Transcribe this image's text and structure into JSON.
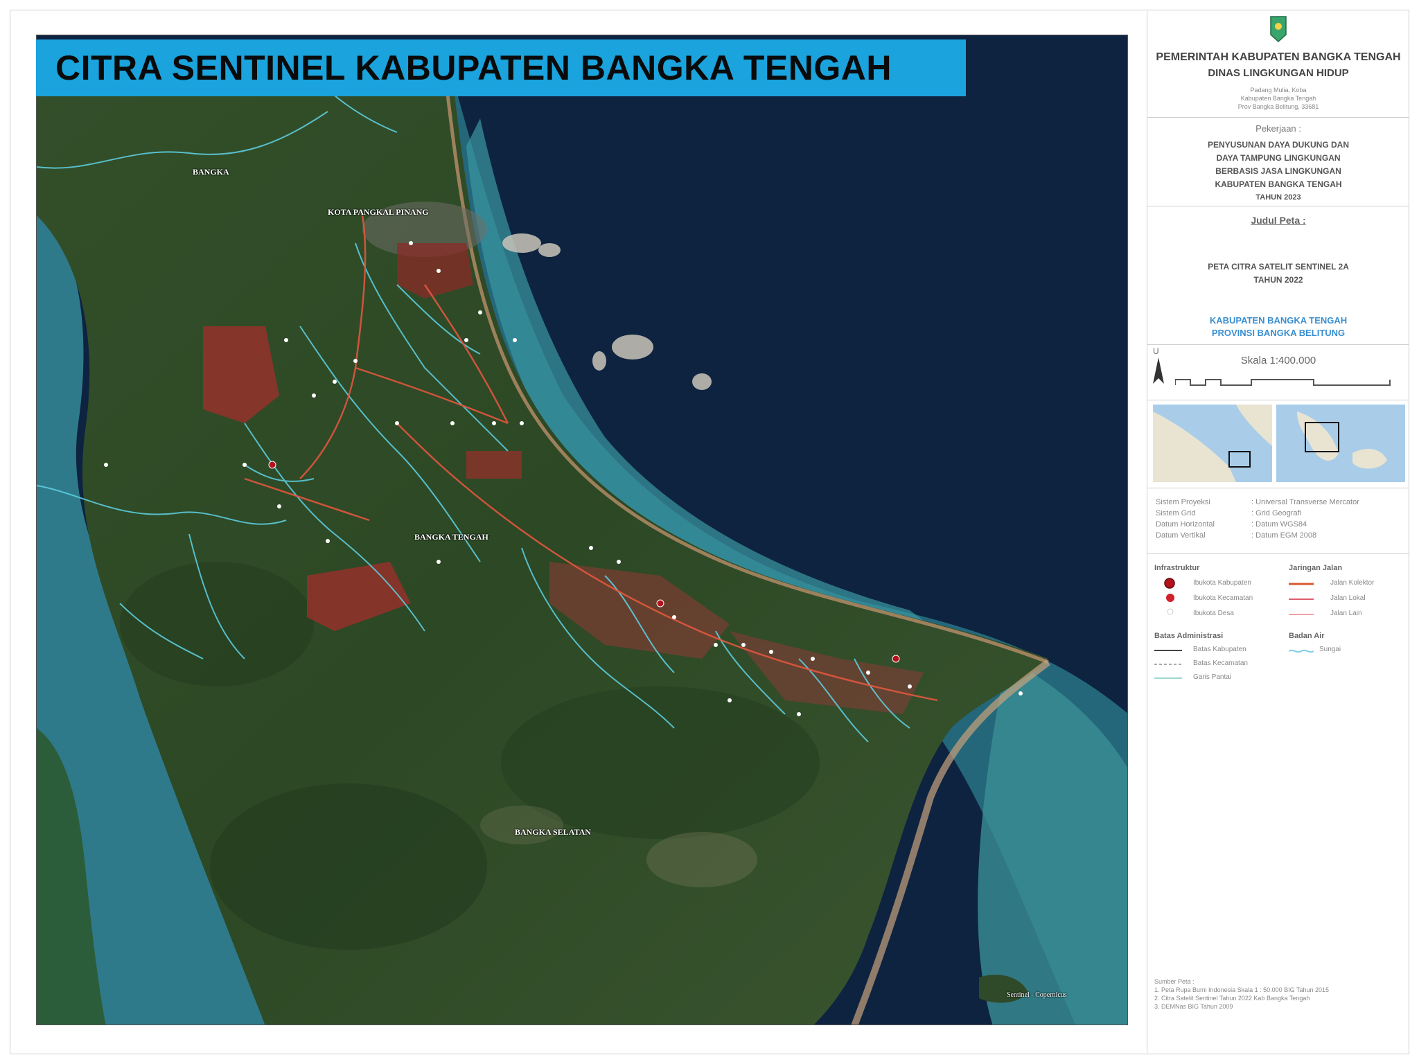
{
  "banner": {
    "title": "CITRA SENTINEL KABUPATEN BANGKA TENGAH"
  },
  "map_labels": {
    "bangka": "BANGKA",
    "pangkalpinang": "KOTA PANGKAL PINANG",
    "bangka_tengah": "BANGKA TENGAH",
    "bangka_selatan": "BANGKA SELATAN",
    "watermark": "Sentinel - Copernicus"
  },
  "panel": {
    "gov_line1": "PEMERINTAH KABUPATEN BANGKA TENGAH",
    "gov_line2": "DINAS LINGKUNGAN HIDUP",
    "address": [
      "Padang Mulia, Koba",
      "Kabupaten Bangka Tengah",
      "Prov Bangka Belitung, 33681"
    ],
    "job_label": "Pekerjaan :",
    "job_lines": [
      "PENYUSUNAN DAYA DUKUNG DAN",
      "DAYA TAMPUNG LINGKUNGAN",
      "BERBASIS JASA LINGKUNGAN",
      "KABUPATEN BANGKA TENGAH",
      "TAHUN 2023"
    ],
    "map_title_label": "Judul Peta :",
    "map_title_lines": [
      "PETA CITRA SATELIT SENTINEL 2A",
      "TAHUN 2022"
    ],
    "region_lines": [
      "KABUPATEN BANGKA TENGAH",
      "PROVINSI BANGKA BELITUNG"
    ],
    "north": "U",
    "scale": "Skala 1:400.000",
    "projection": [
      {
        "key": "Sistem Proyeksi",
        "value": ": Universal Transverse Mercator"
      },
      {
        "key": "Sistem Grid",
        "value": ": Grid Geografi"
      },
      {
        "key": "Datum Horizontal",
        "value": ": Datum WGS84"
      },
      {
        "key": "Datum Vertikal",
        "value": ": Datum EGM 2008"
      }
    ],
    "legend": {
      "infra_title": "Infrastruktur",
      "infra_items": [
        "Ibukota Kabupaten",
        "Ibukota Kecamatan",
        "Ibukota Desa"
      ],
      "road_title": "Jaringan Jalan",
      "road_items": [
        "Jalan Kolektor",
        "Jalan Lokal",
        "Jalan Lain"
      ],
      "admin_title": "Batas Administrasi",
      "admin_items": [
        "Batas Kabupaten",
        "Batas Kecamatan",
        "Garis Pantai"
      ],
      "water_title": "Badan Air",
      "water_items": [
        "Sungai"
      ]
    },
    "sources_title": "Sumber Peta :",
    "sources": [
      "1. Peta Rupa Bumi Indonesia Skala 1 : 50.000 BIG Tahun 2015",
      "2. Citra Satelit Sentinel Tahun 2022 Kab Bangka Tengah",
      "3. DEMNas BIG Tahun 2009"
    ]
  },
  "colors": {
    "banner": "#1aa3dc",
    "sea": "#0e2340",
    "land": "#2d4a26",
    "river": "#5fd3e8",
    "road": "#e0563f",
    "regency_capital": "#b5121b",
    "region_text": "#3a8fd1"
  },
  "icons": [
    "north-arrow-icon",
    "government-emblem-icon"
  ]
}
